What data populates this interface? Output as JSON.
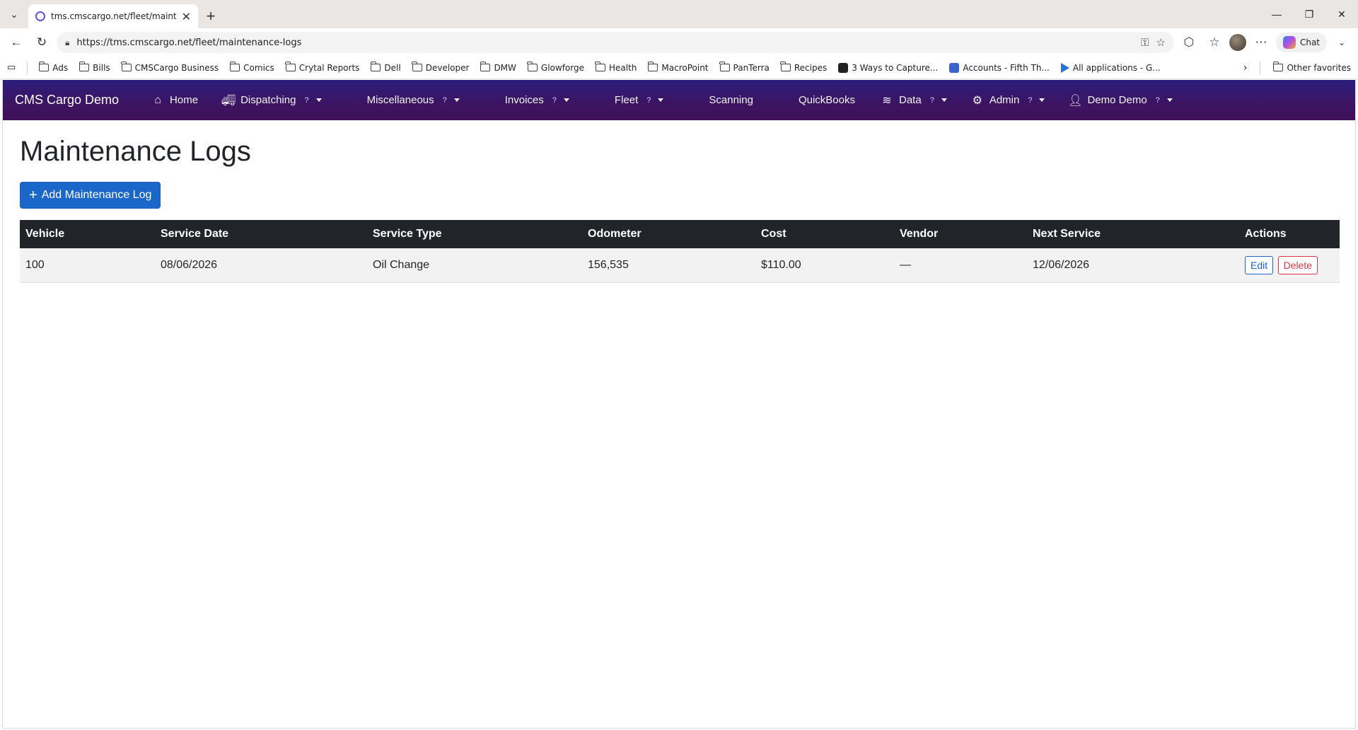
{
  "browser": {
    "tab_title": "tms.cmscargo.net/fleet/maintenance-logs",
    "url": "https://tms.cmscargo.net/fleet/maintenance-logs",
    "chat_label": "Chat",
    "bookmarks": [
      "Ads",
      "Bills",
      "CMSCargo Business",
      "Comics",
      "Crytal Reports",
      "Dell",
      "Developer",
      "DMW",
      "Glowforge",
      "Health",
      "MacroPoint",
      "PanTerra",
      "Recipes",
      "3 Ways to Capture...",
      "Accounts - Fifth Th...",
      "All applications - G..."
    ],
    "other_favorites": "Other favorites"
  },
  "app": {
    "brand": "CMS Cargo Demo",
    "nav": {
      "home": "Home",
      "dispatching": "Dispatching",
      "miscellaneous": "Miscellaneous",
      "invoices": "Invoices",
      "fleet": "Fleet",
      "scanning": "Scanning",
      "quickbooks": "QuickBooks",
      "data": "Data",
      "admin": "Admin",
      "user": "Demo Demo",
      "help_mark": "?"
    },
    "page_title": "Maintenance Logs",
    "add_button": "Add Maintenance Log",
    "add_button_plus": "+",
    "table": {
      "headers": [
        "Vehicle",
        "Service Date",
        "Service Type",
        "Odometer",
        "Cost",
        "Vendor",
        "Next Service",
        "Actions"
      ],
      "rows": [
        {
          "vehicle": "100",
          "service_date": "08/06/2026",
          "service_type": "Oil Change",
          "odometer": "156,535",
          "cost": "$110.00",
          "vendor": "—",
          "next_service": "12/06/2026",
          "edit": "Edit",
          "delete": "Delete"
        }
      ]
    }
  },
  "colors": {
    "nav_gradient_start": "#2a1d7c",
    "nav_gradient_end": "#40105a",
    "primary": "#1b67c9",
    "danger": "#dc3545",
    "table_header": "#212529"
  }
}
